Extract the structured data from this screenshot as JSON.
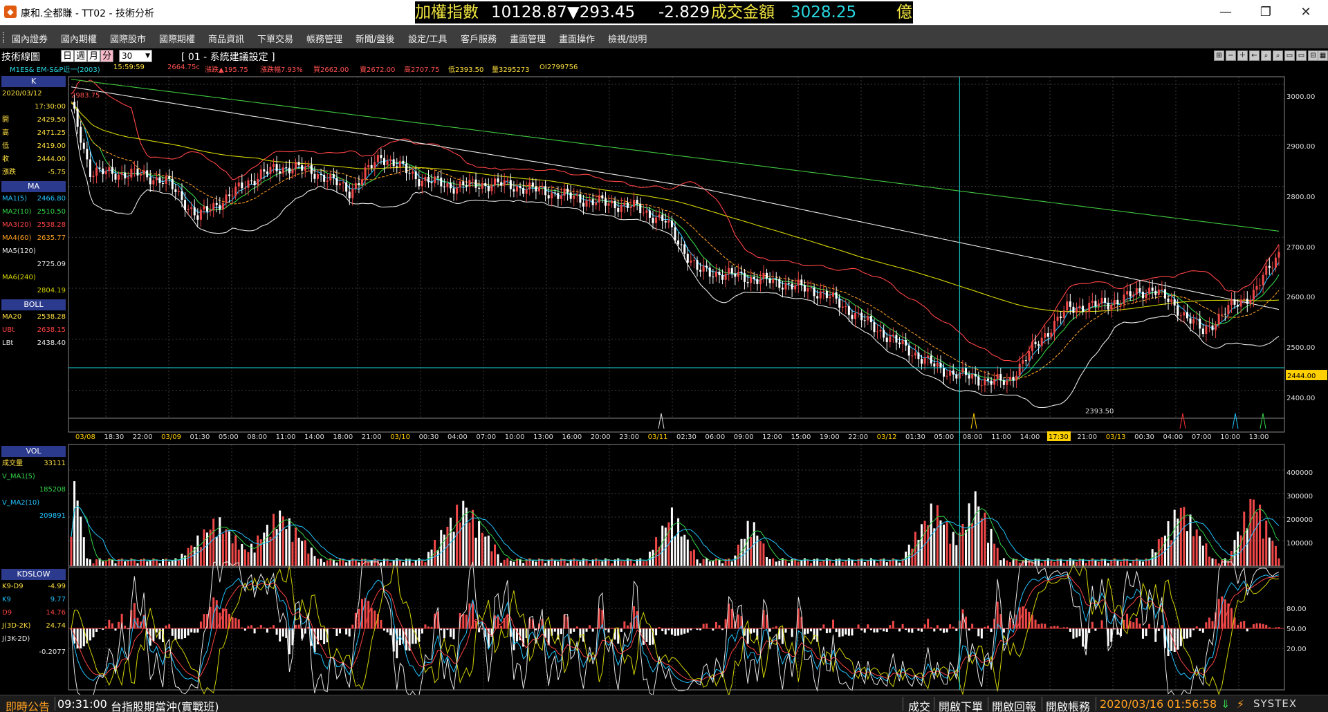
{
  "window": {
    "title": "康和.全都賺 - TT02 - 技術分析",
    "controls": {
      "minimize": "—",
      "maximize": "❐",
      "close": "✕"
    }
  },
  "ticker": {
    "index_name": "加權指數",
    "index_value": "10128.87",
    "index_change": "▼293.45",
    "index_pct": "-2.829",
    "turnover_label": "成交金額",
    "turnover_value": "3028.25",
    "turnover_unit": "億"
  },
  "menu": [
    "國內證券",
    "國內期權",
    "國際股市",
    "國際期權",
    "商品資訊",
    "下單交易",
    "帳務管理",
    "新聞/盤後",
    "設定/工具",
    "客戶服務",
    "畫面管理",
    "畫面操作",
    "檢視/說明"
  ],
  "toolbar": {
    "title": "技術線圖",
    "timeframes": [
      "日",
      "週",
      "月",
      "分"
    ],
    "selected_timeframe": "分",
    "period": "30",
    "system_label": "[ 01 - 系統建議設定 ]",
    "icons": [
      "⊞",
      "−",
      "＋",
      "←",
      "⌕",
      "⌕",
      "▭",
      "▭",
      "⊟",
      "▦"
    ]
  },
  "quote": {
    "symbol": "M1ES& EM-S&P近一(2003)",
    "time": "15:59:59",
    "last": "2664.75c",
    "change": "漲跌▲195.75",
    "pct": "漲跌幅7.93%",
    "bid": "買2662.00",
    "ask": "賣2672.00",
    "high": "高2707.75",
    "low": "低2393.50",
    "volume": "量3295273",
    "oi": "OI2799756"
  },
  "panel_k": {
    "header": "K",
    "date": "2020/03/12",
    "time": "17:30:00",
    "rows": [
      {
        "label": "開",
        "value": "2429.50"
      },
      {
        "label": "高",
        "value": "2471.25"
      },
      {
        "label": "低",
        "value": "2419.00"
      },
      {
        "label": "收",
        "value": "2444.00"
      },
      {
        "label": "漲跌",
        "value": "-5.75"
      }
    ]
  },
  "panel_ma": {
    "header": "MA",
    "rows": [
      {
        "label": "MA1(5)",
        "value": "2466.80"
      },
      {
        "label": "MA2(10)",
        "value": "2510.50"
      },
      {
        "label": "MA3(20)",
        "value": "2538.28"
      },
      {
        "label": "MA4(60)",
        "value": "2635.77"
      },
      {
        "label": "MA5(120)",
        "value": "2725.09"
      },
      {
        "label": "MA6(240)",
        "value": "2804.19"
      }
    ]
  },
  "panel_boll": {
    "header": "BOLL",
    "rows": [
      {
        "label": "MA20",
        "value": "2538.28"
      },
      {
        "label": "UBt",
        "value": "2638.15"
      },
      {
        "label": "LBt",
        "value": "2438.40"
      }
    ]
  },
  "panel_vol": {
    "header": "VOL",
    "rows": [
      {
        "label": "成交量",
        "value": "33111"
      },
      {
        "label": "V_MA1(5)",
        "value": "185208"
      },
      {
        "label": "V_MA2(10)",
        "value": "209891"
      }
    ]
  },
  "panel_kd": {
    "header": "KDSLOW",
    "rows": [
      {
        "label": "K9-D9",
        "value": "-4.99"
      },
      {
        "label": "K9",
        "value": "9.77"
      },
      {
        "label": "D9",
        "value": "14.76"
      },
      {
        "label": "J(3D-2K)",
        "value": "24.74"
      },
      {
        "label": "J(3K-2D)",
        "value": "-0.2077"
      }
    ]
  },
  "colors": {
    "ma1": "#22c4ff",
    "ma2": "#34d648",
    "ma3": "#ff4444",
    "ma4": "#ffa020",
    "ma5": "#e8e8e8",
    "ma6": "#d4d400",
    "up": "#f04848",
    "down": "#ffffff",
    "grid": "#3a3a3a",
    "cursor": "#1ad8d8",
    "ma240": "#40c840"
  },
  "main_chart": {
    "high_label": "2983.75",
    "low_label": "2393.50",
    "cursor_price": "2444.00",
    "cursor_time": "17:30",
    "y_ticks": [
      "3000.00",
      "2900.00",
      "2800.00",
      "2700.00",
      "2600.00",
      "2500.00",
      "2400.00"
    ],
    "x_labels": [
      {
        "t": "03/08",
        "d": true
      },
      {
        "t": "18:30"
      },
      {
        "t": "22:00"
      },
      {
        "t": "03/09",
        "d": true
      },
      {
        "t": "01:30"
      },
      {
        "t": "05:00"
      },
      {
        "t": "08:00"
      },
      {
        "t": "11:00"
      },
      {
        "t": "14:00"
      },
      {
        "t": "18:00"
      },
      {
        "t": "21:00"
      },
      {
        "t": "03/10",
        "d": true
      },
      {
        "t": "00:30"
      },
      {
        "t": "04:00"
      },
      {
        "t": "07:00"
      },
      {
        "t": "10:00"
      },
      {
        "t": "13:00"
      },
      {
        "t": "16:00"
      },
      {
        "t": "20:00"
      },
      {
        "t": "23:00"
      },
      {
        "t": "03/11",
        "d": true
      },
      {
        "t": "02:30"
      },
      {
        "t": "06:00"
      },
      {
        "t": "09:00"
      },
      {
        "t": "12:00"
      },
      {
        "t": "15:00"
      },
      {
        "t": "19:00"
      },
      {
        "t": "22:00"
      },
      {
        "t": "03/12",
        "d": true
      },
      {
        "t": "01:30"
      },
      {
        "t": "05:00"
      },
      {
        "t": "08:00"
      },
      {
        "t": "11:00"
      },
      {
        "t": "14:00"
      },
      {
        "t": "17:30",
        "c": true
      },
      {
        "t": "21:00"
      },
      {
        "t": "03/13",
        "d": true
      },
      {
        "t": "00:30"
      },
      {
        "t": "04:00"
      },
      {
        "t": "07:00"
      },
      {
        "t": "10:00"
      },
      {
        "t": "13:00"
      }
    ]
  },
  "vol_chart": {
    "y_ticks": [
      "400000",
      "300000",
      "200000",
      "100000"
    ]
  },
  "kd_chart": {
    "y_ticks": [
      "80.00",
      "50.00",
      "20.00"
    ]
  },
  "status": {
    "notice_label": "即時公告",
    "notice_time": "09:31:00",
    "notice_text": "台指股期當沖(實戰班)",
    "buttons": [
      "成交",
      "開啟下單",
      "開啟回報",
      "開啟帳務"
    ],
    "datetime": "2020/03/16 01:56:58",
    "brand": "SYSTEX"
  }
}
